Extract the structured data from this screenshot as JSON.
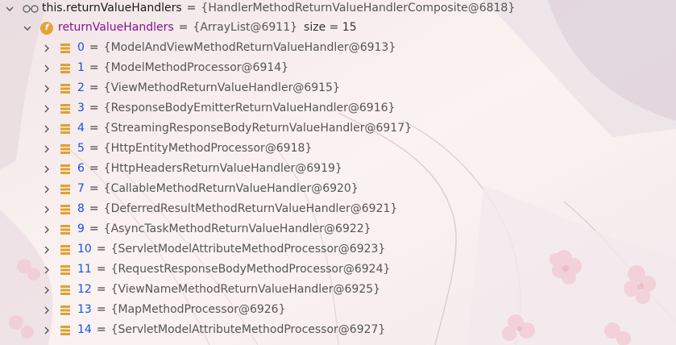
{
  "root": {
    "name": "this.returnValueHandlers",
    "value": "{HandlerMethodReturnValueHandlerComposite@6818}",
    "icon": "glasses-icon"
  },
  "field": {
    "name": "returnValueHandlers",
    "value": "{ArrayList@6911}",
    "size_text": "size = 15",
    "icon_letter": "f"
  },
  "items": [
    {
      "index": "0",
      "value": "{ModelAndViewMethodReturnValueHandler@6913}"
    },
    {
      "index": "1",
      "value": "{ModelMethodProcessor@6914}"
    },
    {
      "index": "2",
      "value": "{ViewMethodReturnValueHandler@6915}"
    },
    {
      "index": "3",
      "value": "{ResponseBodyEmitterReturnValueHandler@6916}"
    },
    {
      "index": "4",
      "value": "{StreamingResponseBodyReturnValueHandler@6917}"
    },
    {
      "index": "5",
      "value": "{HttpEntityMethodProcessor@6918}"
    },
    {
      "index": "6",
      "value": "{HttpHeadersReturnValueHandler@6919}"
    },
    {
      "index": "7",
      "value": "{CallableMethodReturnValueHandler@6920}"
    },
    {
      "index": "8",
      "value": "{DeferredResultMethodReturnValueHandler@6921}"
    },
    {
      "index": "9",
      "value": "{AsyncTaskMethodReturnValueHandler@6922}"
    },
    {
      "index": "10",
      "value": "{ServletModelAttributeMethodProcessor@6923}"
    },
    {
      "index": "11",
      "value": "{RequestResponseBodyMethodProcessor@6924}"
    },
    {
      "index": "12",
      "value": "{ViewNameMethodReturnValueHandler@6925}"
    },
    {
      "index": "13",
      "value": "{MapMethodProcessor@6926}"
    },
    {
      "index": "14",
      "value": "{ServletModelAttributeMethodProcessor@6927}"
    }
  ],
  "symbols": {
    "equals": "="
  },
  "colors": {
    "field_badge": "#e8a23a",
    "list_icon": "#e0a030",
    "index": "#1750eb",
    "field_name": "#871094"
  }
}
